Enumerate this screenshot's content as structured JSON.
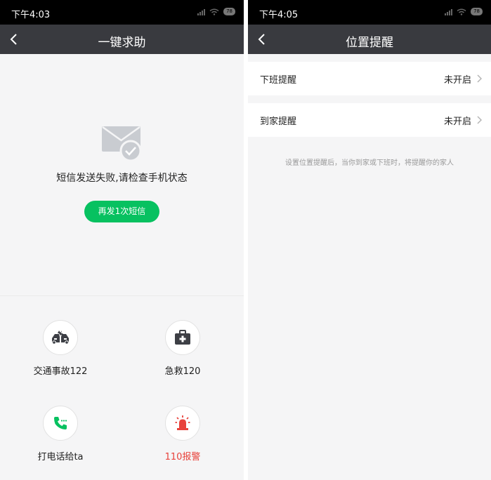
{
  "left": {
    "status_time": "下午4:03",
    "battery": "78",
    "title": "一键求助",
    "message": "短信发送失败,请检查手机状态",
    "resend_label": "再发1次短信",
    "actions": [
      {
        "label": "交通事故122",
        "icon": "car-accident-icon"
      },
      {
        "label": "急救120",
        "icon": "first-aid-kit-icon"
      },
      {
        "label": "打电话给ta",
        "icon": "phone-icon"
      },
      {
        "label": "110报警",
        "icon": "siren-icon"
      }
    ]
  },
  "right": {
    "status_time": "下午4:05",
    "battery": "78",
    "title": "位置提醒",
    "items": [
      {
        "label": "下班提醒",
        "value": "未开启"
      },
      {
        "label": "到家提醒",
        "value": "未开启"
      }
    ],
    "hint": "设置位置提醒后，当你到家或下班时，将提醒你的家人"
  },
  "colors": {
    "accent_green": "#07c160",
    "alert_red": "#e8423b",
    "titlebar": "#393a3f"
  }
}
